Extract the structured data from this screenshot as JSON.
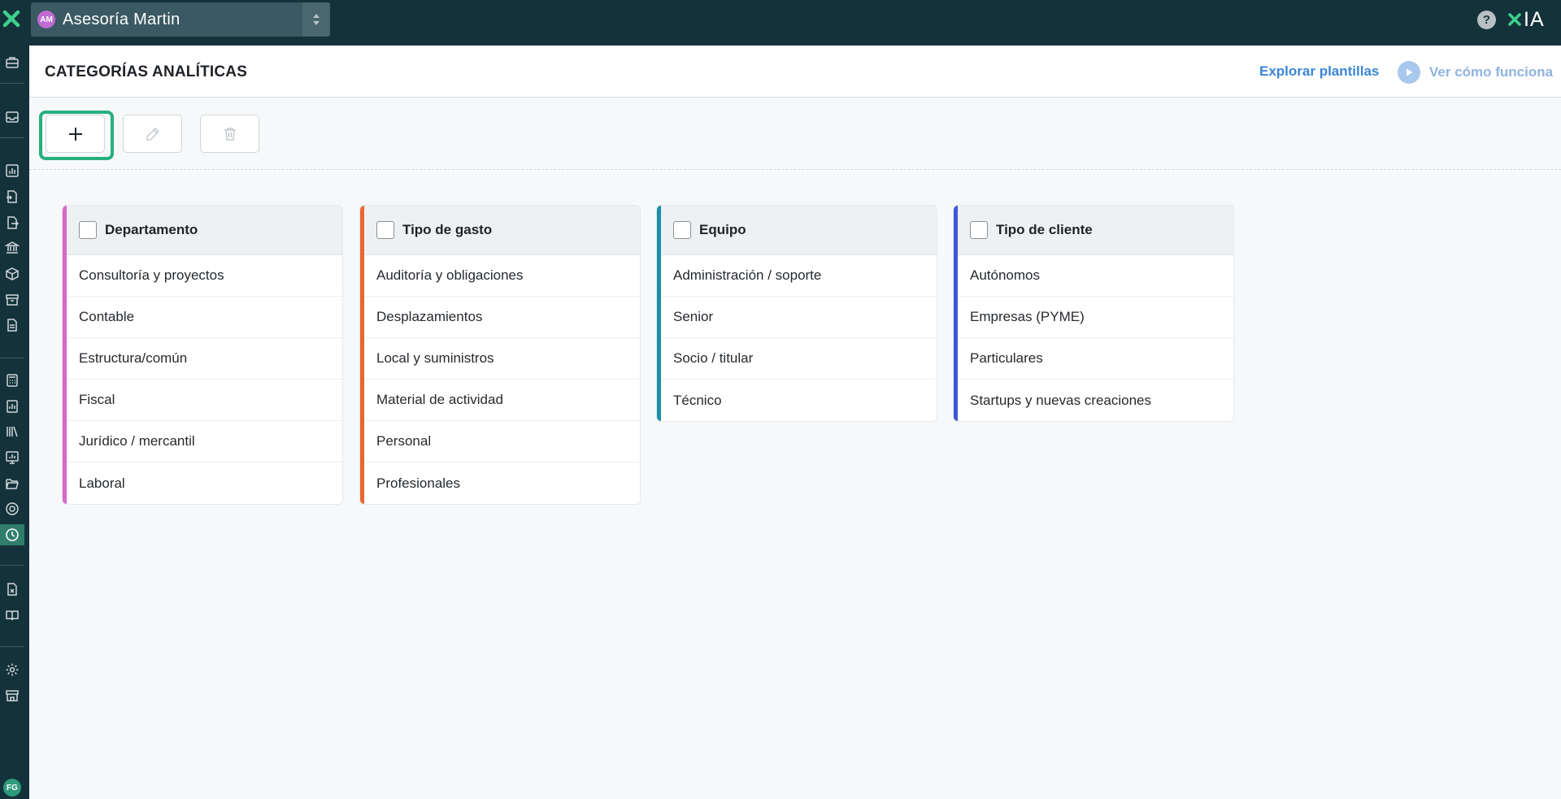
{
  "topbar": {
    "company_initials": "AM",
    "company_name": "Asesoría Martin",
    "help_label": "?",
    "xia_label": "IA"
  },
  "header": {
    "title": "CATEGORÍAS ANALÍTICAS",
    "explore_label": "Explorar plantillas",
    "howto_label": "Ver cómo funciona"
  },
  "user": {
    "initials": "FG"
  },
  "colors": {
    "accent_green": "#27b07e",
    "departamento": "#d569c9",
    "tipo_gasto": "#e8672e",
    "equipo": "#1a8fa8",
    "tipo_cliente": "#3f57d6"
  },
  "categories": [
    {
      "title": "Departamento",
      "items": [
        "Consultoría y proyectos",
        "Contable",
        "Estructura/común",
        "Fiscal",
        "Jurídico / mercantil",
        "Laboral"
      ]
    },
    {
      "title": "Tipo de gasto",
      "items": [
        "Auditoría y obligaciones",
        "Desplazamientos",
        "Local y suministros",
        "Material de actividad",
        "Personal",
        "Profesionales"
      ]
    },
    {
      "title": "Equipo",
      "items": [
        "Administración / soporte",
        "Senior",
        "Socio / titular",
        "Técnico"
      ]
    },
    {
      "title": "Tipo de cliente",
      "items": [
        "Autónomos",
        "Empresas (PYME)",
        "Particulares",
        "Startups y nuevas creaciones"
      ]
    }
  ]
}
